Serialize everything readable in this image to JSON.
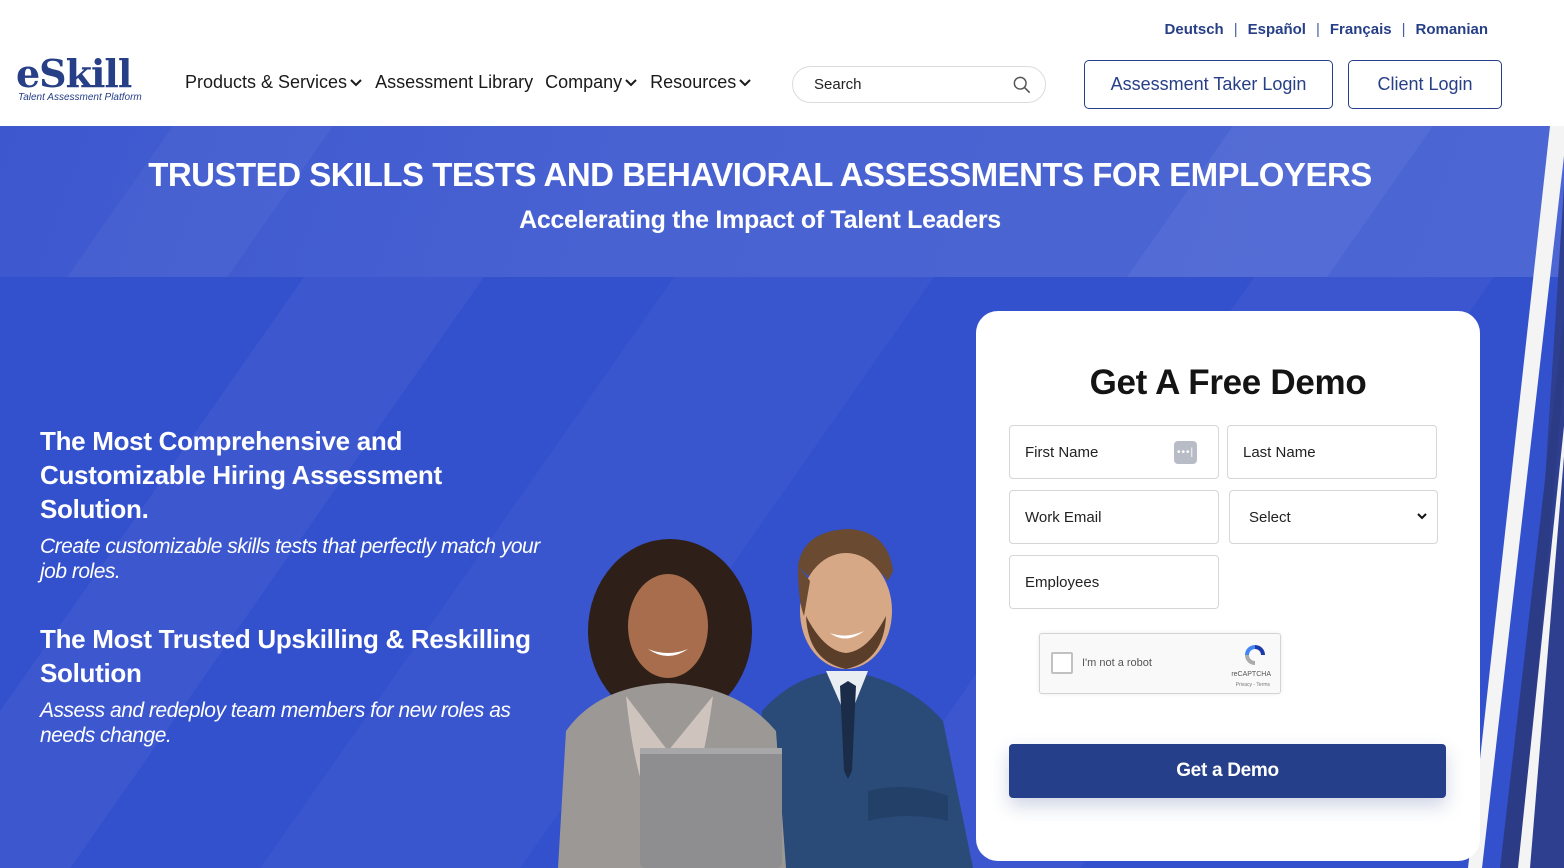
{
  "header": {
    "logo": {
      "word": "eSkill",
      "tagline": "Talent Assessment Platform"
    },
    "languages": [
      "Deutsch",
      "Español",
      "Français",
      "Romanian"
    ],
    "nav": [
      {
        "label": "Products & Services",
        "has_dropdown": true
      },
      {
        "label": "Assessment Library",
        "has_dropdown": false
      },
      {
        "label": "Company",
        "has_dropdown": true
      },
      {
        "label": "Resources",
        "has_dropdown": true
      }
    ],
    "search": {
      "placeholder": "Search",
      "value": "",
      "icon": "search-icon"
    },
    "buttons": {
      "assessment_taker_login": "Assessment Taker Login",
      "client_login": "Client Login"
    }
  },
  "hero": {
    "title": "TRUSTED SKILLS TESTS AND BEHAVIORAL ASSESSMENTS FOR EMPLOYERS",
    "subtitle": "Accelerating the Impact of Talent Leaders",
    "blocks": [
      {
        "heading": "The Most Comprehensive and Customizable Hiring Assessment Solution.",
        "text": "Create customizable skills tests that perfectly match your job roles."
      },
      {
        "heading": "The Most Trusted Upskilling & Reskilling Solution",
        "text": "Assess and redeploy team members for new roles as needs change."
      }
    ],
    "image_alt": "Two smiling professionals - a woman holding a laptop and a man with crossed arms"
  },
  "demo_form": {
    "title": "Get A Free Demo",
    "fields": {
      "first_name": {
        "placeholder": "First Name",
        "value": ""
      },
      "last_name": {
        "placeholder": "Last Name",
        "value": ""
      },
      "work_email": {
        "placeholder": "Work Email",
        "value": ""
      },
      "select": {
        "selected": "Select"
      },
      "employees": {
        "placeholder": "Employees",
        "value": ""
      }
    },
    "captcha": {
      "label": "I'm not a robot",
      "brand": "reCAPTCHA",
      "links": "Privacy - Terms",
      "checked": false
    },
    "submit_label": "Get a Demo"
  },
  "colors": {
    "brand_navy": "#263f86",
    "hero_blue": "#3350cd",
    "button_navy": "#263f8a",
    "card_bg": "#ffffff"
  }
}
